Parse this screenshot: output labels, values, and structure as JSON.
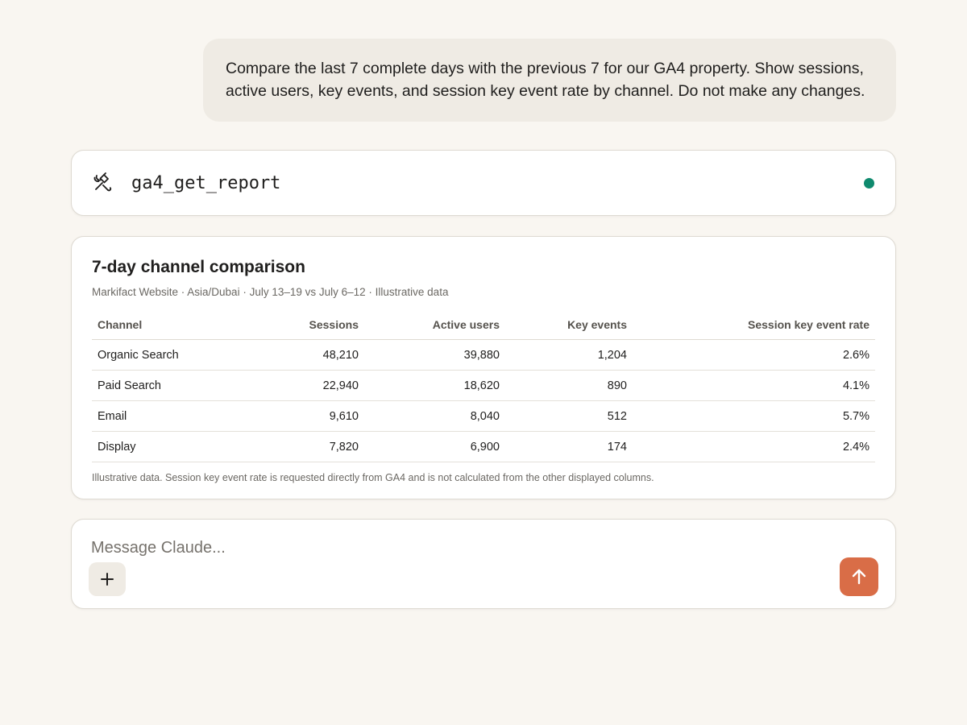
{
  "conversation": {
    "user_message": "Compare the last 7 complete days with the previous 7 for our GA4 property. Show sessions, active users, key events, and session key event rate by channel. Do not make any changes."
  },
  "tool_call": {
    "name": "ga4_get_report",
    "icon": "hammer-wrench-icon",
    "status": "complete",
    "status_color": "#0f8a6e"
  },
  "report": {
    "title": "7-day channel comparison",
    "subtitle": "Markifact Website · Asia/Dubai · July 13–19 vs July 6–12 · Illustrative data",
    "columns": [
      "Channel",
      "Sessions",
      "Active users",
      "Key events",
      "Session key event rate"
    ],
    "rows": [
      [
        "Organic Search",
        "48,210",
        "39,880",
        "1,204",
        "2.6%"
      ],
      [
        "Paid Search",
        "22,940",
        "18,620",
        "890",
        "4.1%"
      ],
      [
        "Email",
        "9,610",
        "8,040",
        "512",
        "5.7%"
      ],
      [
        "Display",
        "7,820",
        "6,900",
        "174",
        "2.4%"
      ]
    ],
    "footnote": "Illustrative data. Session key event rate is requested directly from GA4 and is not calculated from the other displayed columns."
  },
  "composer": {
    "placeholder": "Message Claude...",
    "value": "",
    "plus_icon": "plus-icon",
    "send_icon": "arrow-up-icon",
    "send_color": "#d96d47"
  }
}
